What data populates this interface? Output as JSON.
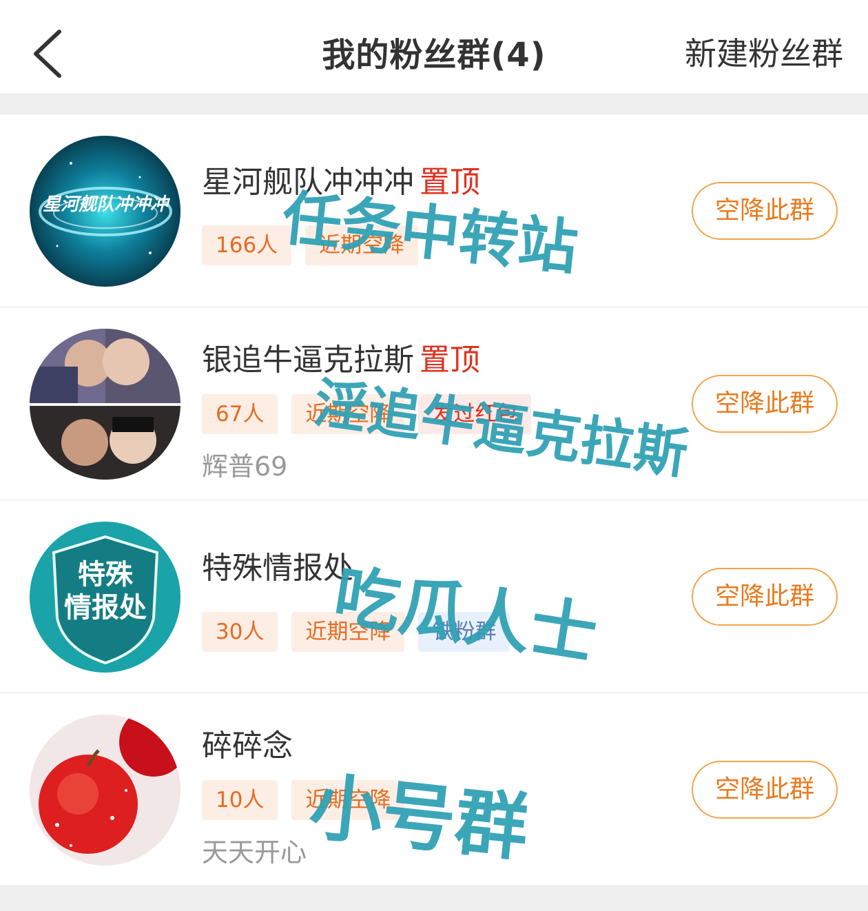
{
  "header": {
    "back_icon": "chevron-left-icon",
    "title": "我的粉丝群(4)",
    "new_group": "新建粉丝群"
  },
  "groups": [
    {
      "name": "星河舰队冲冲冲",
      "pinned": "置顶",
      "avatar_text": "星河舰队冲冲冲",
      "tags": [
        "166人",
        "近期空降"
      ],
      "sub": "",
      "action": "空降此群"
    },
    {
      "name": "银追牛逼克拉斯",
      "pinned": "置顶",
      "tags": [
        "67人",
        "近期空降",
        "发过红包"
      ],
      "sub": "辉普69",
      "action": "空降此群"
    },
    {
      "name": "特殊情报处",
      "pinned": "",
      "avatar_text_line1": "特殊",
      "avatar_text_line2": "情报处",
      "tags": [
        "30人",
        "近期空降",
        "铁粉群"
      ],
      "sub": "",
      "action": "空降此群"
    },
    {
      "name": "碎碎念",
      "pinned": "",
      "tags": [
        "10人",
        "近期空降"
      ],
      "sub": "天天开心",
      "action": "空降此群"
    }
  ],
  "watermarks": [
    "任务中转站",
    "淫追牛逼克拉斯",
    "吃瓜人士",
    "小号群"
  ],
  "colors": {
    "accent_orange": "#ea7a1e",
    "pin_red": "#e0301e",
    "watermark_teal": "#2ea0b4"
  }
}
